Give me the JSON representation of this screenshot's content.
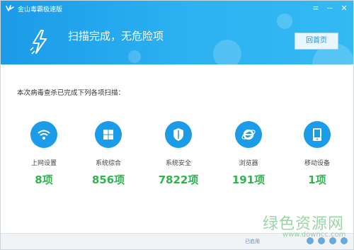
{
  "app": {
    "title": "金山毒霸极速版",
    "controls": {
      "menu": "≡",
      "minimize": "−",
      "close": "✕"
    }
  },
  "header": {
    "message": "扫描完成，无危险项",
    "back_button": "回首页"
  },
  "summary": "本次病毒查杀已完成下列各项扫描：",
  "items": [
    {
      "label": "上网设置",
      "count": "8项",
      "icon": "wifi-icon"
    },
    {
      "label": "系统综合",
      "count": "856项",
      "icon": "windows-icon"
    },
    {
      "label": "系统安全",
      "count": "7822项",
      "icon": "shield-icon"
    },
    {
      "label": "浏览器",
      "count": "191项",
      "icon": "ie-browser-icon"
    },
    {
      "label": "移动设备",
      "count": "1项",
      "icon": "mobile-icon"
    }
  ],
  "footer": {
    "text": "已启用"
  },
  "watermark": {
    "text": "绿色资源网",
    "url": "www.downcc.com"
  },
  "colors": {
    "header": "#1b9be8",
    "accent": "#30b44f",
    "icon_bg": "#1b9be8"
  }
}
